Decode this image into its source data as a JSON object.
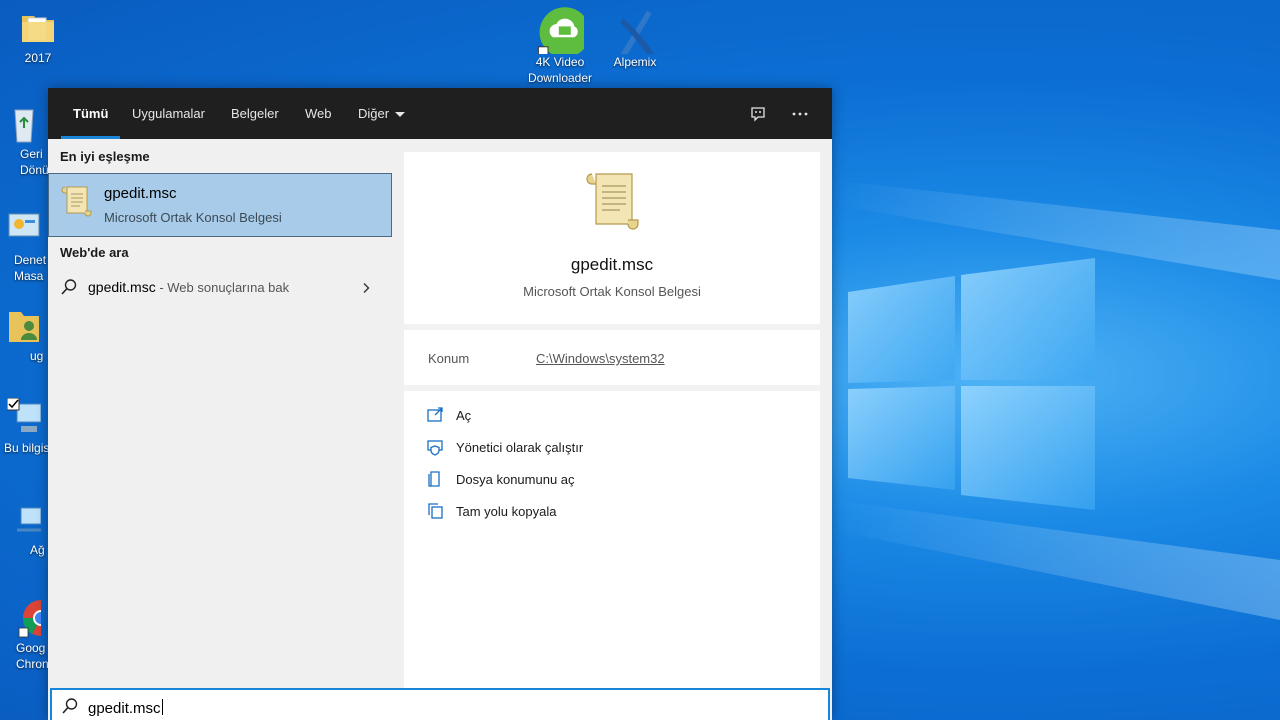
{
  "desktop": {
    "icons": [
      {
        "label": "2017"
      },
      {
        "label": "4K Video\nDownloader"
      },
      {
        "label": "Alpemix"
      }
    ],
    "left_partial": [
      {
        "label": "Geri\nDönüş"
      },
      {
        "label": "Denet\nMasa"
      },
      {
        "label": "ug"
      },
      {
        "label": "Bu bilgis"
      },
      {
        "label": "Ağ"
      },
      {
        "label": "Goog\nChron"
      }
    ]
  },
  "search": {
    "tabs": [
      {
        "label": "Tümü",
        "active": true
      },
      {
        "label": "Uygulamalar"
      },
      {
        "label": "Belgeler"
      },
      {
        "label": "Web"
      },
      {
        "label": "Diğer"
      }
    ],
    "best_match_heading": "En iyi eşleşme",
    "best_match": {
      "name": "gpedit.msc",
      "type": "Microsoft Ortak Konsol Belgesi"
    },
    "web_heading": "Web'de ara",
    "web_result": {
      "query": "gpedit.msc",
      "hint": " - Web sonuçlarına bak"
    },
    "detail": {
      "name": "gpedit.msc",
      "type": "Microsoft Ortak Konsol Belgesi",
      "location_label": "Konum",
      "location_value": "C:\\Windows\\system32",
      "actions": [
        {
          "label": "Aç",
          "icon": "open-window-icon"
        },
        {
          "label": "Yönetici olarak çalıştır",
          "icon": "shield-icon"
        },
        {
          "label": "Dosya konumunu aç",
          "icon": "file-location-icon"
        },
        {
          "label": "Tam yolu kopyala",
          "icon": "copy-icon"
        }
      ]
    },
    "input_value": "gpedit.msc"
  },
  "colors": {
    "accent": "#1a86d9",
    "selection": "#a7cbe8",
    "topbar": "#1f1f1f"
  }
}
